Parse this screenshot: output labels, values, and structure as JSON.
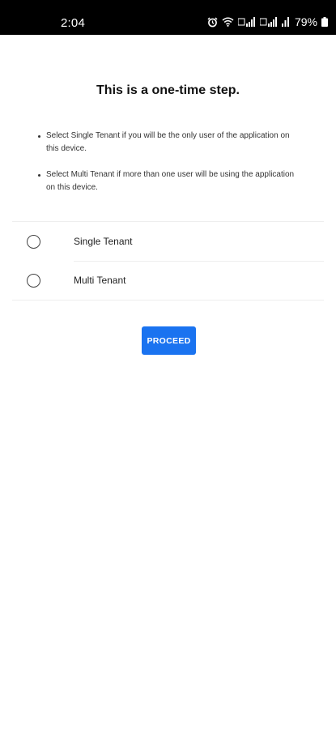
{
  "status_bar": {
    "time": "2:04",
    "battery": "79%",
    "icons": [
      "alarm-icon",
      "wifi-icon",
      "signal-icon",
      "signal-icon",
      "signal-icon",
      "battery-icon"
    ]
  },
  "title": "This is a one-time step.",
  "instructions": [
    "Select Single Tenant if you will be the only user of the application on this device.",
    "Select Multi Tenant if more than one user will be using the application on this device."
  ],
  "options": [
    {
      "label": "Single Tenant",
      "selected": false
    },
    {
      "label": "Multi Tenant",
      "selected": false
    }
  ],
  "proceed_label": "PROCEED",
  "colors": {
    "accent": "#1a73f0",
    "status_bar": "#000000",
    "background": "#ffffff"
  }
}
